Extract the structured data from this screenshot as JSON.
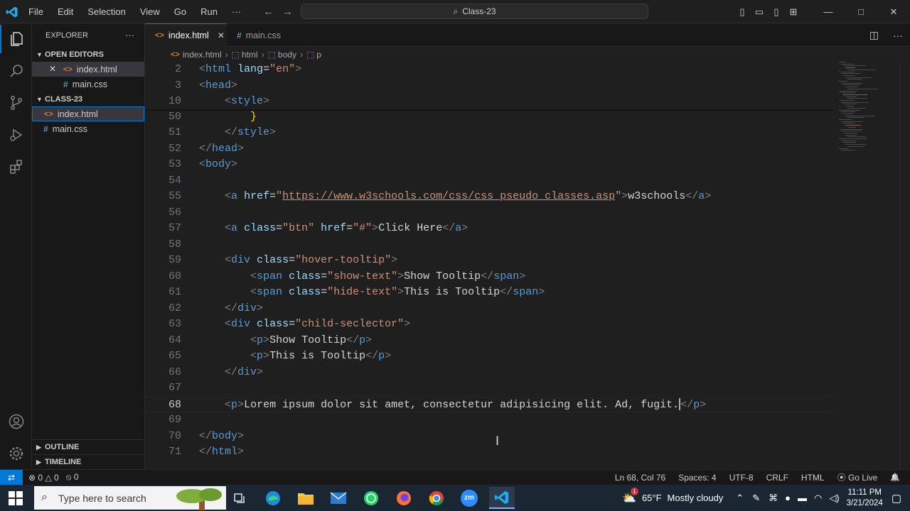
{
  "window": {
    "menu": [
      "File",
      "Edit",
      "Selection",
      "View",
      "Go",
      "Run",
      "···"
    ],
    "command_center": "Class-23",
    "controls": {
      "minimize": "—",
      "maximize": "□",
      "close": "✕"
    }
  },
  "explorer": {
    "title": "EXPLORER",
    "more": "···",
    "open_editors_label": "OPEN EDITORS",
    "open_editors": [
      {
        "name": "index.html",
        "type": "html",
        "icon": "<>",
        "close": "✕"
      },
      {
        "name": "main.css",
        "type": "css",
        "icon": "#"
      }
    ],
    "folder_label": "CLASS-23",
    "files": [
      {
        "name": "index.html",
        "type": "html",
        "icon": "<>"
      },
      {
        "name": "main.css",
        "type": "css",
        "icon": "#"
      }
    ],
    "outline_label": "OUTLINE",
    "timeline_label": "TIMELINE"
  },
  "tabs": [
    {
      "label": "index.html",
      "icon": "<>",
      "close": "✕",
      "active": true
    },
    {
      "label": "main.css",
      "icon": "#",
      "active": false
    }
  ],
  "breadcrumb": [
    {
      "label": "index.html",
      "icon": "<>"
    },
    {
      "label": "html",
      "icon": "⬚"
    },
    {
      "label": "body",
      "icon": "⬚"
    },
    {
      "label": "p",
      "icon": "⬚"
    }
  ],
  "current_line": 68,
  "code_lines": [
    {
      "n": "2",
      "tokens": [
        [
          "b",
          "<"
        ],
        [
          "t",
          "html"
        ],
        [
          "tx",
          " "
        ],
        [
          "a",
          "lang"
        ],
        [
          "tx",
          "="
        ],
        [
          "s",
          "\"en\""
        ],
        [
          "b",
          ">"
        ]
      ]
    },
    {
      "n": "3",
      "tokens": [
        [
          "b",
          "<"
        ],
        [
          "t",
          "head"
        ],
        [
          "b",
          ">"
        ]
      ]
    },
    {
      "n": "10",
      "tokens": [
        [
          "tx",
          "    "
        ],
        [
          "b",
          "<"
        ],
        [
          "t",
          "style"
        ],
        [
          "b",
          ">"
        ]
      ]
    },
    {
      "n": "50",
      "tokens": [
        [
          "tx",
          "        "
        ],
        [
          "y",
          "}"
        ]
      ]
    },
    {
      "n": "51",
      "tokens": [
        [
          "tx",
          "    "
        ],
        [
          "b",
          "</"
        ],
        [
          "t",
          "style"
        ],
        [
          "b",
          ">"
        ]
      ]
    },
    {
      "n": "52",
      "tokens": [
        [
          "b",
          "</"
        ],
        [
          "t",
          "head"
        ],
        [
          "b",
          ">"
        ]
      ]
    },
    {
      "n": "53",
      "tokens": [
        [
          "b",
          "<"
        ],
        [
          "t",
          "body"
        ],
        [
          "b",
          ">"
        ]
      ]
    },
    {
      "n": "54",
      "tokens": []
    },
    {
      "n": "55",
      "tokens": [
        [
          "tx",
          "    "
        ],
        [
          "b",
          "<"
        ],
        [
          "t",
          "a"
        ],
        [
          "tx",
          " "
        ],
        [
          "a",
          "href"
        ],
        [
          "tx",
          "="
        ],
        [
          "s",
          "\""
        ],
        [
          "su",
          "https://www.w3schools.com/css/css_pseudo_classes.asp"
        ],
        [
          "s",
          "\""
        ],
        [
          "b",
          ">"
        ],
        [
          "tx",
          "w3schools"
        ],
        [
          "b",
          "</"
        ],
        [
          "t",
          "a"
        ],
        [
          "b",
          ">"
        ]
      ]
    },
    {
      "n": "56",
      "tokens": []
    },
    {
      "n": "57",
      "tokens": [
        [
          "tx",
          "    "
        ],
        [
          "b",
          "<"
        ],
        [
          "t",
          "a"
        ],
        [
          "tx",
          " "
        ],
        [
          "a",
          "class"
        ],
        [
          "tx",
          "="
        ],
        [
          "s",
          "\"btn\""
        ],
        [
          "tx",
          " "
        ],
        [
          "a",
          "href"
        ],
        [
          "tx",
          "="
        ],
        [
          "s",
          "\"#\""
        ],
        [
          "b",
          ">"
        ],
        [
          "tx",
          "Click Here"
        ],
        [
          "b",
          "</"
        ],
        [
          "t",
          "a"
        ],
        [
          "b",
          ">"
        ]
      ]
    },
    {
      "n": "58",
      "tokens": []
    },
    {
      "n": "59",
      "tokens": [
        [
          "tx",
          "    "
        ],
        [
          "b",
          "<"
        ],
        [
          "t",
          "div"
        ],
        [
          "tx",
          " "
        ],
        [
          "a",
          "class"
        ],
        [
          "tx",
          "="
        ],
        [
          "s",
          "\"hover-tooltip\""
        ],
        [
          "b",
          ">"
        ]
      ]
    },
    {
      "n": "60",
      "tokens": [
        [
          "tx",
          "        "
        ],
        [
          "b",
          "<"
        ],
        [
          "t",
          "span"
        ],
        [
          "tx",
          " "
        ],
        [
          "a",
          "class"
        ],
        [
          "tx",
          "="
        ],
        [
          "s",
          "\"show-text\""
        ],
        [
          "b",
          ">"
        ],
        [
          "tx",
          "Show Tooltip"
        ],
        [
          "b",
          "</"
        ],
        [
          "t",
          "span"
        ],
        [
          "b",
          ">"
        ]
      ]
    },
    {
      "n": "61",
      "tokens": [
        [
          "tx",
          "        "
        ],
        [
          "b",
          "<"
        ],
        [
          "t",
          "span"
        ],
        [
          "tx",
          " "
        ],
        [
          "a",
          "class"
        ],
        [
          "tx",
          "="
        ],
        [
          "s",
          "\"hide-text\""
        ],
        [
          "b",
          ">"
        ],
        [
          "tx",
          "This is Tooltip"
        ],
        [
          "b",
          "</"
        ],
        [
          "t",
          "span"
        ],
        [
          "b",
          ">"
        ]
      ]
    },
    {
      "n": "62",
      "tokens": [
        [
          "tx",
          "    "
        ],
        [
          "b",
          "</"
        ],
        [
          "t",
          "div"
        ],
        [
          "b",
          ">"
        ]
      ]
    },
    {
      "n": "63",
      "tokens": [
        [
          "tx",
          "    "
        ],
        [
          "b",
          "<"
        ],
        [
          "t",
          "div"
        ],
        [
          "tx",
          " "
        ],
        [
          "a",
          "class"
        ],
        [
          "tx",
          "="
        ],
        [
          "s",
          "\"child-seclector\""
        ],
        [
          "b",
          ">"
        ]
      ]
    },
    {
      "n": "64",
      "tokens": [
        [
          "tx",
          "        "
        ],
        [
          "b",
          "<"
        ],
        [
          "t",
          "p"
        ],
        [
          "b",
          ">"
        ],
        [
          "tx",
          "Show Tooltip"
        ],
        [
          "b",
          "</"
        ],
        [
          "t",
          "p"
        ],
        [
          "b",
          ">"
        ]
      ]
    },
    {
      "n": "65",
      "tokens": [
        [
          "tx",
          "        "
        ],
        [
          "b",
          "<"
        ],
        [
          "t",
          "p"
        ],
        [
          "b",
          ">"
        ],
        [
          "tx",
          "This is Tooltip"
        ],
        [
          "b",
          "</"
        ],
        [
          "t",
          "p"
        ],
        [
          "b",
          ">"
        ]
      ]
    },
    {
      "n": "66",
      "tokens": [
        [
          "tx",
          "    "
        ],
        [
          "b",
          "</"
        ],
        [
          "t",
          "div"
        ],
        [
          "b",
          ">"
        ]
      ]
    },
    {
      "n": "67",
      "tokens": []
    },
    {
      "n": "68",
      "tokens": [
        [
          "tx",
          "    "
        ],
        [
          "b",
          "<"
        ],
        [
          "t",
          "p"
        ],
        [
          "b",
          ">"
        ],
        [
          "tx",
          "Lorem ipsum dolor sit amet, consectetur adipisicing elit. Ad, fugit."
        ],
        [
          "caret",
          ""
        ],
        [
          "b",
          "</"
        ],
        [
          "t",
          "p"
        ],
        [
          "b",
          ">"
        ]
      ]
    },
    {
      "n": "69",
      "tokens": []
    },
    {
      "n": "70",
      "tokens": [
        [
          "b",
          "</"
        ],
        [
          "t",
          "body"
        ],
        [
          "b",
          ">"
        ]
      ]
    },
    {
      "n": "71",
      "tokens": [
        [
          "b",
          "</"
        ],
        [
          "t",
          "html"
        ],
        [
          "b",
          ">"
        ]
      ]
    }
  ],
  "status": {
    "remote": "⇄",
    "errors": "0",
    "warnings": "0",
    "ports": "0",
    "position": "Ln 68, Col 76",
    "spaces": "Spaces: 4",
    "encoding": "UTF-8",
    "eol": "CRLF",
    "language": "HTML",
    "golive": "Go Live",
    "bell": "🔔"
  },
  "taskbar": {
    "search_placeholder": "Type here to search",
    "weather_temp": "65°F",
    "weather_text": "Mostly cloudy",
    "weather_badge": "1",
    "time": "11:11 PM",
    "date": "3/21/2024",
    "apps": [
      "task-view",
      "edge",
      "file-explorer",
      "mail",
      "whatsapp",
      "firefox",
      "chrome",
      "zoom",
      "vscode"
    ],
    "zoom_label": "zm"
  },
  "colors": {
    "accent": "#0078d4",
    "tag": "#569cd6",
    "attr": "#9cdcfe",
    "string": "#ce9178",
    "bracket": "#808080",
    "text": "#d4d4d4",
    "brace": "#ffd700"
  }
}
